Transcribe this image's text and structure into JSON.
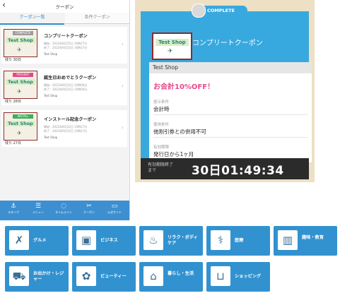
{
  "phone": {
    "title": "クーポン",
    "back": "‹",
    "tabs": [
      "クーポン一覧",
      "条件クーポン"
    ],
    "coupons": [
      {
        "ribbon": "COMPLETE",
        "ribbon_color": "#9c9c9c",
        "shop": "Test Shop",
        "remain": "残り 30日",
        "name": "コンプリートクーポン",
        "date1": "開始：2022年8月25日 16時27分",
        "date2": "終了：2022年9月25日 16時27分",
        "shop_name": "Test Shop"
      },
      {
        "ribbon": "PRESENT",
        "ribbon_color": "#e24a85",
        "shop": "Test Shop",
        "remain": "残り 28日",
        "name": "誕生日おめでとうクーポン",
        "date1": "開始：2022年8月22日 10時00分",
        "date2": "終了：2022年9月22日 10時00分",
        "shop_name": "Test Shop"
      },
      {
        "ribbon": "INSTALL",
        "ribbon_color": "#3fae57",
        "shop": "Test Shop",
        "remain": "残り 27日",
        "name": "インストール記念クーポン",
        "date1": "開始：2022年8月22日 15時27分",
        "date2": "終了：2022年9月22日 15時27分",
        "shop_name": "Test Shop"
      }
    ],
    "nav": [
      {
        "icon": "stamp-icon",
        "glyph": "⚓",
        "label": "スタンプ"
      },
      {
        "icon": "menu-icon",
        "glyph": "☰",
        "label": "メニュー"
      },
      {
        "icon": "timeline-icon",
        "glyph": "◌",
        "label": "タイムライン"
      },
      {
        "icon": "coupon-icon",
        "glyph": "✂",
        "label": "クーポン"
      },
      {
        "icon": "website-icon",
        "glyph": "▭",
        "label": "公式サイト"
      }
    ]
  },
  "coupon_detail": {
    "badge": "COMPLETE",
    "shop": "Test Shop",
    "name": "コンプリートクーポン",
    "shop_header": "Test Shop",
    "discount": "お会計10%OFF！",
    "fields": [
      {
        "label": "提示条件",
        "value": "会計時"
      },
      {
        "label": "使用条件",
        "value": "他割引券との併用不可"
      },
      {
        "label": "有効期限",
        "value": "発行日から1ヶ月"
      }
    ],
    "footer_label": "有効期限終了まで",
    "countdown": "30日01:49:34"
  },
  "categories": [
    {
      "icon": "fork-knife-icon",
      "glyph": "✗",
      "label": "グルメ"
    },
    {
      "icon": "briefcase-icon",
      "glyph": "💼",
      "label": "ビジネス"
    },
    {
      "icon": "relax-icon",
      "glyph": "♨",
      "label": "リラク・ボディケア"
    },
    {
      "icon": "stethoscope-icon",
      "glyph": "⚕",
      "label": "医療"
    },
    {
      "icon": "book-icon",
      "glyph": "📖",
      "label": "趣味・教育"
    },
    {
      "icon": "car-icon",
      "glyph": "🚗",
      "label": "お出かけ・レジャー"
    },
    {
      "icon": "flower-icon",
      "glyph": "✿",
      "label": "ビューティー"
    },
    {
      "icon": "house-icon",
      "glyph": "⌂",
      "label": "暮らし・生活"
    },
    {
      "icon": "basket-icon",
      "glyph": "🛒",
      "label": "ショッピング"
    }
  ]
}
